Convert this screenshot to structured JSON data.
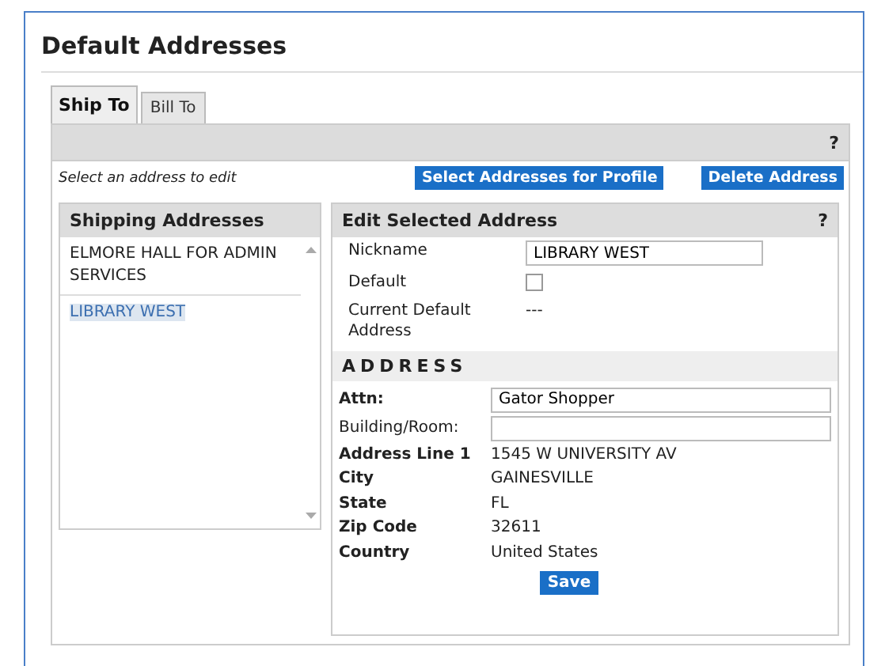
{
  "title": "Default Addresses",
  "tabs": [
    {
      "label": "Ship To",
      "selected": true
    },
    {
      "label": "Bill To",
      "selected": false
    }
  ],
  "toolbar": {
    "help": "?"
  },
  "hint": "Select an address to edit",
  "buttons": [
    "Select Addresses for Profile",
    "Delete Address"
  ],
  "address_list": {
    "title": "Shipping Addresses",
    "items": [
      {
        "label": "ELMORE HALL FOR ADMIN SERVICES",
        "selected": false
      },
      {
        "label": "LIBRARY WEST",
        "selected": true
      }
    ]
  },
  "editor": {
    "title": "Edit Selected Address",
    "help": "?",
    "fields": [
      {
        "kind": "input",
        "label": "Nickname",
        "value": "LIBRARY WEST"
      },
      {
        "kind": "checkbox",
        "label": "Default",
        "checked": false
      },
      {
        "kind": "text",
        "label": "Current Default Address",
        "value": "---"
      }
    ],
    "section": "ADDRESS",
    "address_fields": [
      {
        "kind": "input",
        "label": "Attn:",
        "bold": true,
        "value": "Gator Shopper"
      },
      {
        "kind": "input",
        "label": "Building/Room:",
        "bold": false
      },
      {
        "kind": "text",
        "label": "Address Line 1",
        "bold": true,
        "value": "1545 W UNIVERSITY AV"
      },
      {
        "kind": "text",
        "label": "City",
        "bold": true,
        "value": "GAINESVILLE"
      },
      {
        "kind": "text",
        "label": "State",
        "bold": true,
        "value": "FL"
      },
      {
        "kind": "text",
        "label": "Zip Code",
        "bold": true,
        "value": "32611"
      },
      {
        "kind": "text",
        "label": "Country",
        "bold": true,
        "value": "United States"
      }
    ],
    "save": "Save"
  }
}
